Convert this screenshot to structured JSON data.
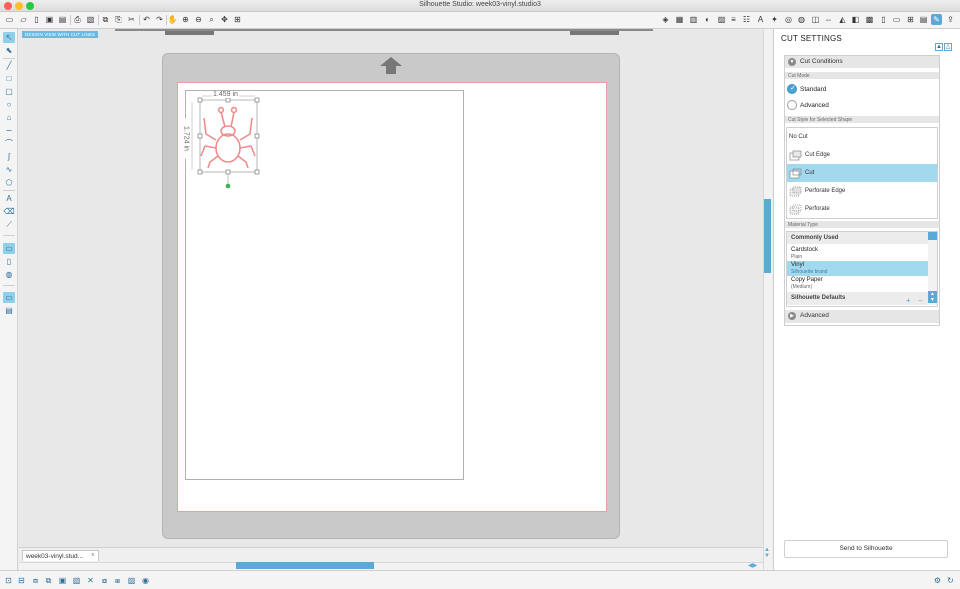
{
  "window": {
    "title": "Silhouette Studio: week03-vinyl.studio3",
    "traffic_colors": [
      "#ff5f57",
      "#febc2e",
      "#28c840"
    ]
  },
  "toolbar": {
    "left_icons": [
      "new-document-icon",
      "open-icon",
      "save-icon",
      "save-library-icon",
      "print-icon",
      "send-print-icon",
      "copy-icon",
      "paste-icon",
      "cut-icon",
      "undo-icon",
      "redo-icon",
      "pan-icon",
      "zoom-in-icon",
      "zoom-out-icon",
      "zoom-select-icon",
      "zoom-drag-icon",
      "fit-page-icon"
    ],
    "right_icons": [
      "fill-icon",
      "line-color-icon",
      "line-style-icon",
      "gradient-icon",
      "align-icon",
      "replicate-icon",
      "text-icon",
      "point-icon",
      "offset-icon",
      "trace-icon",
      "modify-icon",
      "transform-icon",
      "knife-icon",
      "eraser-icon",
      "image-effects-icon",
      "page-setup-icon",
      "registration-icon",
      "grid-icon",
      "layers-icon",
      "library-icon",
      "store-icon",
      "cut-settings-icon",
      "send-icon"
    ]
  },
  "canvas": {
    "design_label": "DESIGN VIEW WITH CUT LINES",
    "width_label": "1.459 in",
    "height_label": "1.724 in",
    "document_tab": "week03-vinyl.stud...",
    "document_tab_close": "x",
    "shape_color": "#f08c8c",
    "handle_color": "#3cb44b"
  },
  "panel": {
    "title": "CUT SETTINGS",
    "cut_conditions": {
      "header": "Cut Conditions",
      "cut_mode_label": "Cut Mode",
      "modes": [
        {
          "label": "Standard",
          "selected": true
        },
        {
          "label": "Advanced",
          "selected": false
        }
      ],
      "cut_style_label": "Cut Style for Selected Shape",
      "cut_styles": [
        {
          "label": "No Cut",
          "selected": false
        },
        {
          "label": "Cut Edge",
          "selected": false
        },
        {
          "label": "Cut",
          "selected": true
        },
        {
          "label": "Perforate Edge",
          "selected": false
        },
        {
          "label": "Perforate",
          "selected": false
        }
      ],
      "material_type_label": "Material Type",
      "commonly_used": "Commonly Used",
      "materials": [
        {
          "name": "Cardstock",
          "sub": "Plain",
          "selected": false
        },
        {
          "name": "Vinyl",
          "sub": "Silhouette brand",
          "selected": true
        },
        {
          "name": "Copy Paper",
          "sub": "(Medium)",
          "selected": false
        }
      ],
      "silhouette_defaults": "Silhouette Defaults",
      "add_symbol": "+",
      "remove_symbol": "−"
    },
    "advanced": {
      "header": "Advanced"
    },
    "send_button": "Send to Silhouette"
  },
  "accent_color": "#5aa9d6"
}
